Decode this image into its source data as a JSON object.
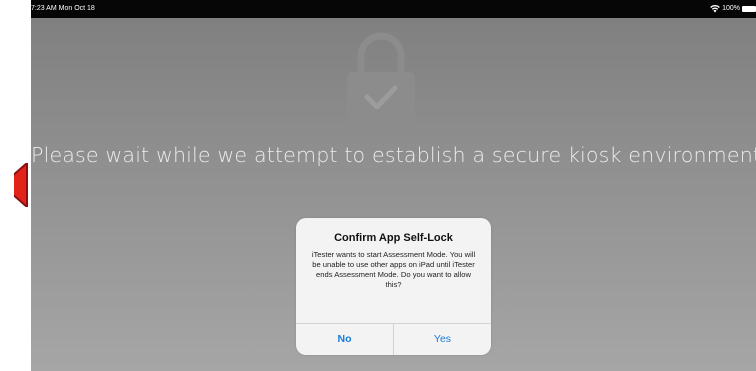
{
  "status_bar": {
    "time_date": "7:23 AM  Mon Oct 18",
    "battery_text": "100%",
    "wifi_icon": "wifi-icon",
    "battery_icon": "battery-icon"
  },
  "background": {
    "lock_icon": "lock-check-icon",
    "message": "Please wait while we attempt to establish a secure kiosk environment..."
  },
  "alert": {
    "title": "Confirm App Self-Lock",
    "body": "iTester wants to start Assessment Mode. You will be unable to use other apps on iPad until iTester ends Assessment Mode. Do you want to allow this?",
    "no_label": "No",
    "yes_label": "Yes"
  },
  "annotation": {
    "arrow_icon": "red-pointer-arrow-icon",
    "arrow_color": "#e2231a"
  },
  "colors": {
    "status_bar": "#060606",
    "dialog_background": "#f3f3f3",
    "button_text": "#1a7ad9"
  }
}
